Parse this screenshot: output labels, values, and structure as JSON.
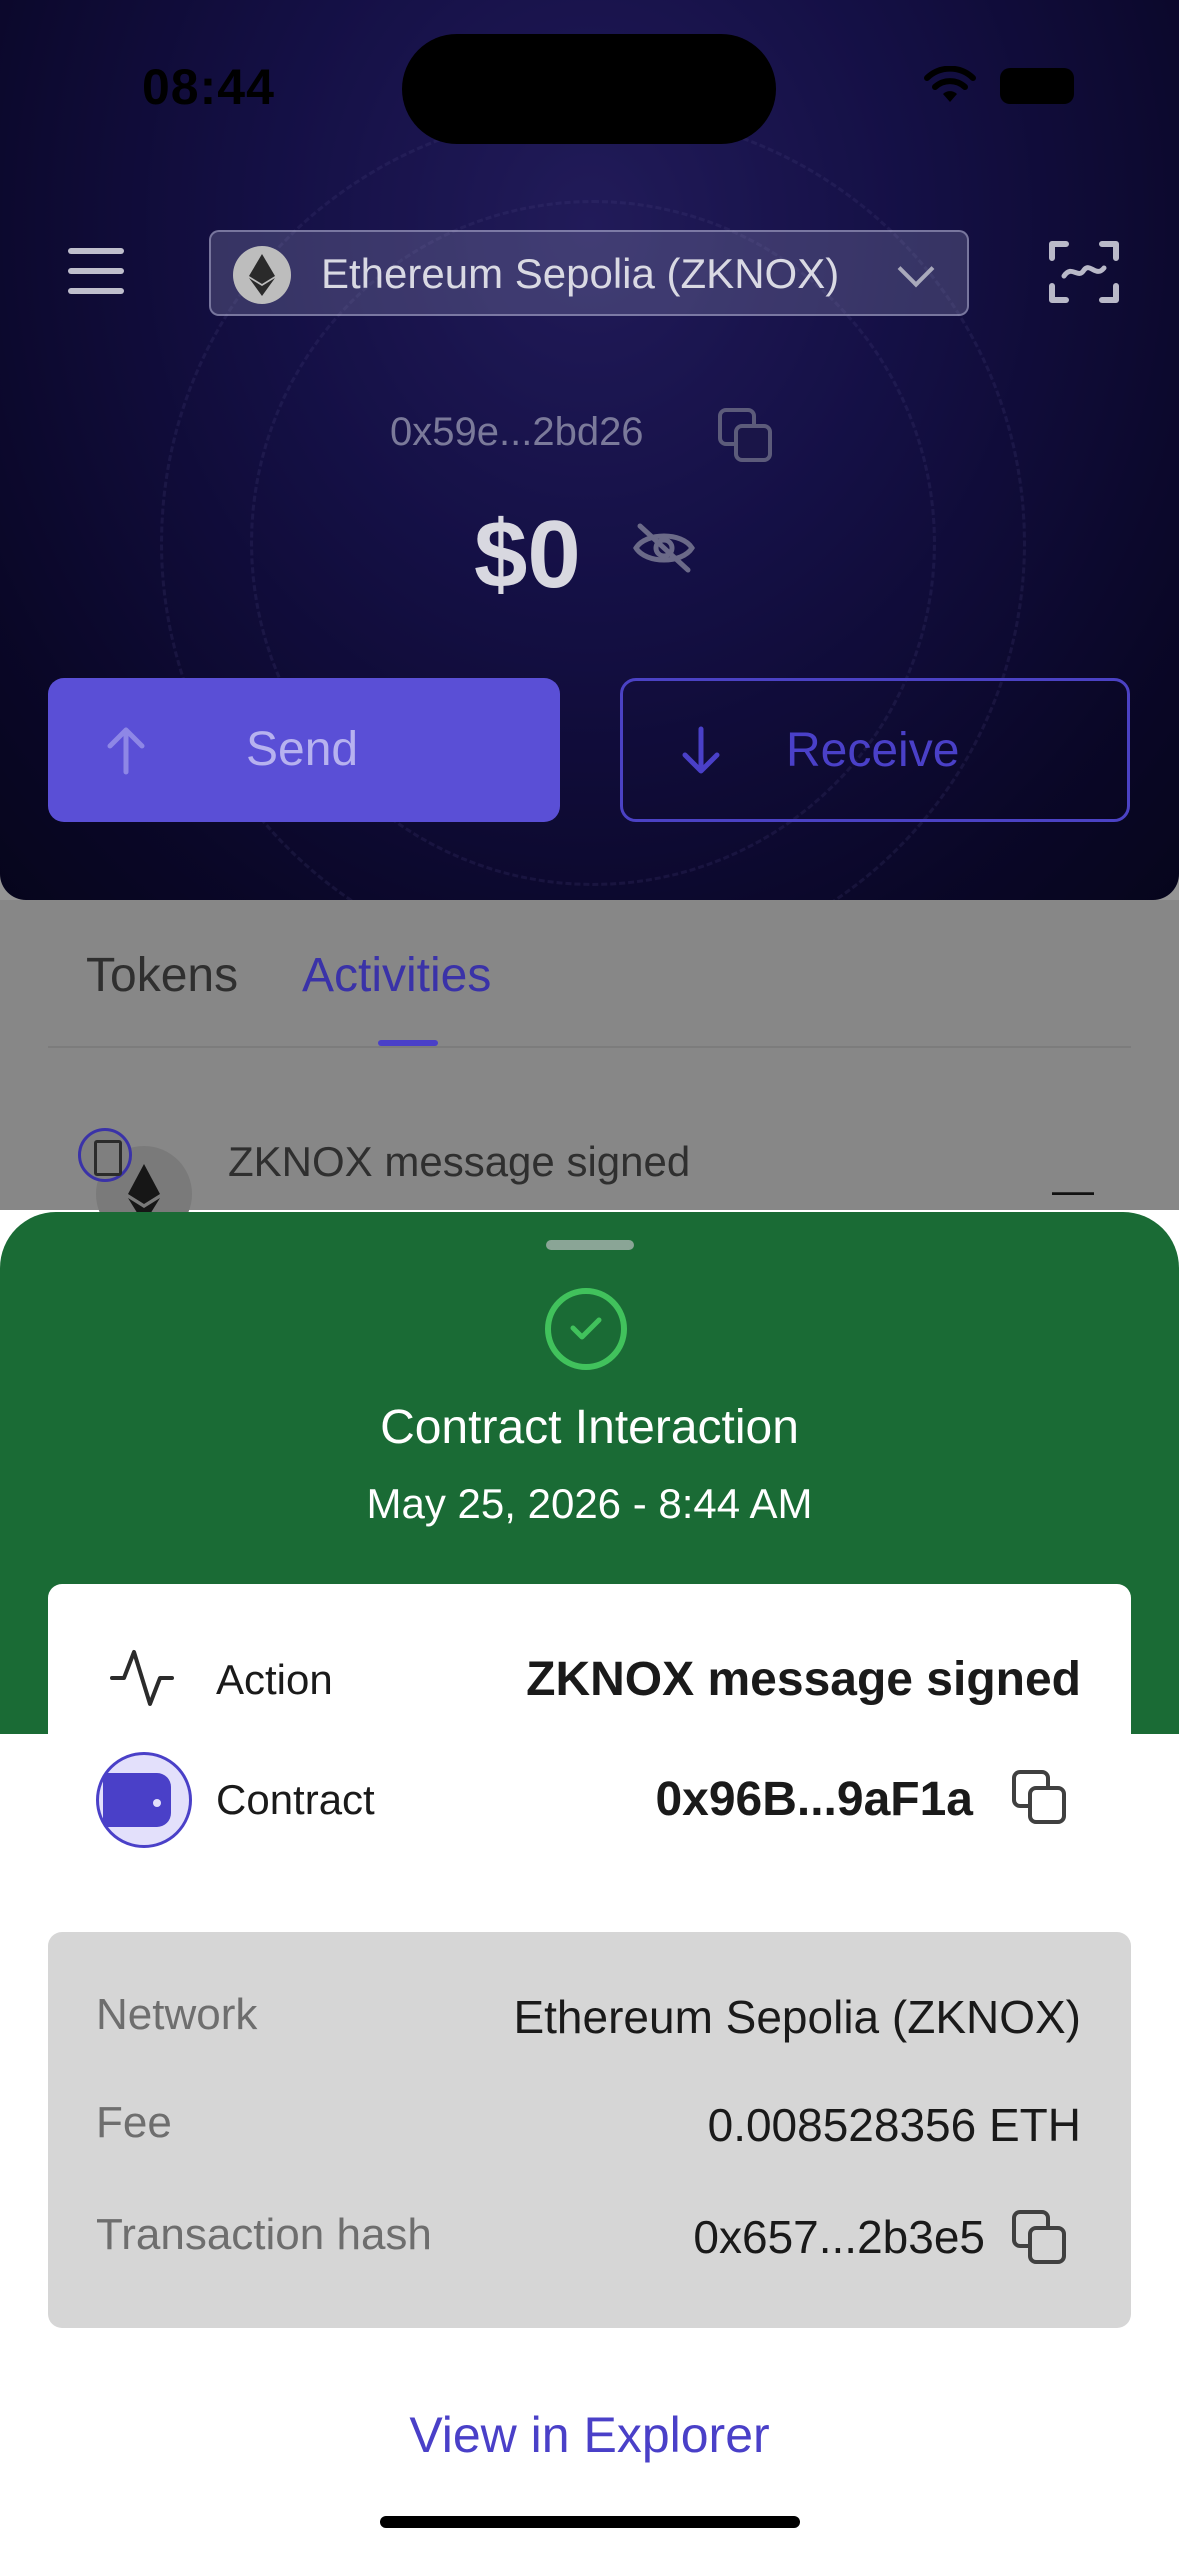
{
  "status_bar": {
    "time": "08:44"
  },
  "header": {
    "network": "Ethereum Sepolia (ZKNOX)",
    "address": "0x59e...2bd26",
    "balance": "$0",
    "send_label": "Send",
    "receive_label": "Receive"
  },
  "tabs": [
    {
      "label": "Tokens",
      "active": false
    },
    {
      "label": "Activities",
      "active": true
    }
  ],
  "activity_item": {
    "title": "ZKNOX message signed",
    "amount": "—"
  },
  "sheet": {
    "title": "Contract Interaction",
    "date": "May 25, 2026 - 8:44 AM",
    "action_label": "Action",
    "action_value": "ZKNOX message signed",
    "contract_label": "Contract",
    "contract_value": "0x96B...9aF1a",
    "network_label": "Network",
    "network_value": "Ethereum Sepolia (ZKNOX)",
    "fee_label": "Fee",
    "fee_value": "0.008528356 ETH",
    "hash_label": "Transaction hash",
    "hash_value": "0x657...2b3e5",
    "explorer_link": "View in Explorer"
  },
  "colors": {
    "accent": "#4a40c8",
    "success_sheet": "#1a6b35",
    "success_check": "#41c25c"
  }
}
